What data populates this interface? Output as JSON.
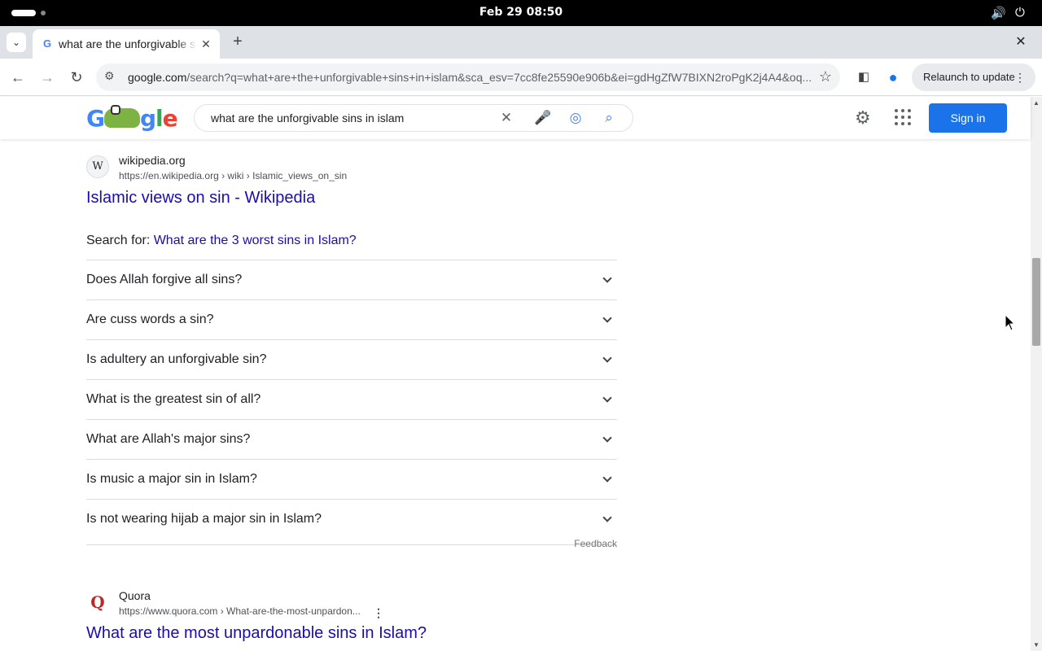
{
  "os_bar": {
    "clock": "Feb 29  08:50"
  },
  "browser": {
    "tab_title": "what are the unforgivable sins in islam - Google Search",
    "url_host": "google.com",
    "url_path": "/search?q=what+are+the+unforgivable+sins+in+islam&sca_esv=7cc8fe25590e906b&ei=gdHgZfW7BIXN2roPgK2j4A4&oq...",
    "relaunch_label": "Relaunch to update"
  },
  "google": {
    "search_query": "what are the unforgivable sins in islam",
    "sign_in_label": "Sign in"
  },
  "results": {
    "wiki": {
      "logo": "W",
      "site_name": "wikipedia.org",
      "cite": "https://en.wikipedia.org › wiki › Islamic_views_on_sin",
      "title": "Islamic views on sin - Wikipedia"
    },
    "search_for_label": "Search for: ",
    "search_for_link": "What are the 3 worst sins in Islam?",
    "people_also_ask": [
      "Does Allah forgive all sins?",
      "Are cuss words a sin?",
      "Is adultery an unforgivable sin?",
      "What is the greatest sin of all?",
      "What are Allah's major sins?",
      "Is music a major sin in Islam?",
      "Is not wearing hijab a major sin in Islam?"
    ],
    "feedback_label": "Feedback",
    "quora": {
      "site_name": "Quora",
      "cite": "https://www.quora.com › What-are-the-most-unpardon...",
      "title": "What are the most unpardonable sins in Islam?"
    }
  },
  "colors": {
    "link": "#1a0dab",
    "accent_blue": "#1a73e8",
    "quora_red": "#b92b27"
  }
}
